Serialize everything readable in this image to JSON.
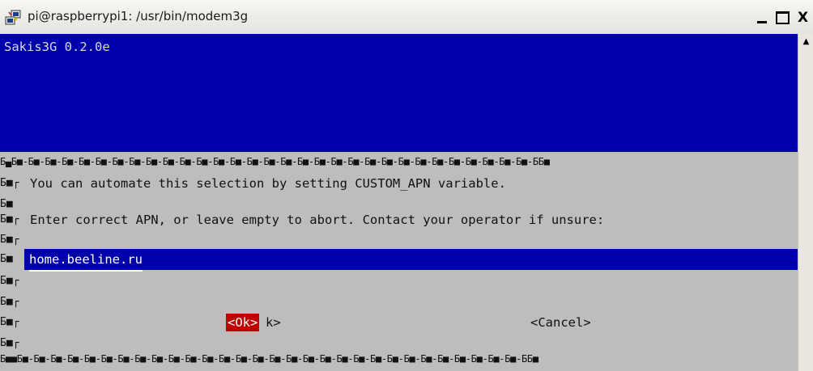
{
  "window": {
    "title": "pi@raspberrypi1: /usr/bin/modem3g",
    "icon": "putty-icon",
    "controls": {
      "minimize": "_",
      "maximize": "□",
      "close": "X"
    }
  },
  "terminal": {
    "backtitle": "Sakis3G 0.2.0e",
    "border_top": "Б▄Б■-Б■-Б■-Б■-Б■-Б■-Б■-Б■-Б■-Б■-Б■-Б■-Б■-Б■-Б■-Б■-Б■-Б■-Б■-Б■-Б■-Б■-Б■-Б■-Б■-Б■-Б■-Б■-Б■-Б■-Б■-ББ■",
    "border_bottom": "Б■■Б■-Б■-Б■-Б■-Б■-Б■-Б■-Б■-Б■-Б■-Б■-Б■-Б■-Б■-Б■-Б■-Б■-Б■-Б■-Б■-Б■-Б■-Б■-Б■-Б■-Б■-Б■-Б■-Б■-Б■-ББ■",
    "edge_glyph": "Б■┌",
    "edge_glyph_plain": "Б■",
    "message_1": "You can automate this selection by setting CUSTOM_APN variable.",
    "message_2": "Enter correct APN, or leave empty to abort. Contact your operator if unsure:",
    "apn_value": "home.beeline.ru",
    "ok_label": "<Ok>",
    "ok_tail": "k>",
    "cancel_label": "<Cancel>"
  },
  "colors": {
    "backdrop": "#0000aa",
    "dialog": "#bdbdbd",
    "ok_highlight": "#c00000"
  }
}
